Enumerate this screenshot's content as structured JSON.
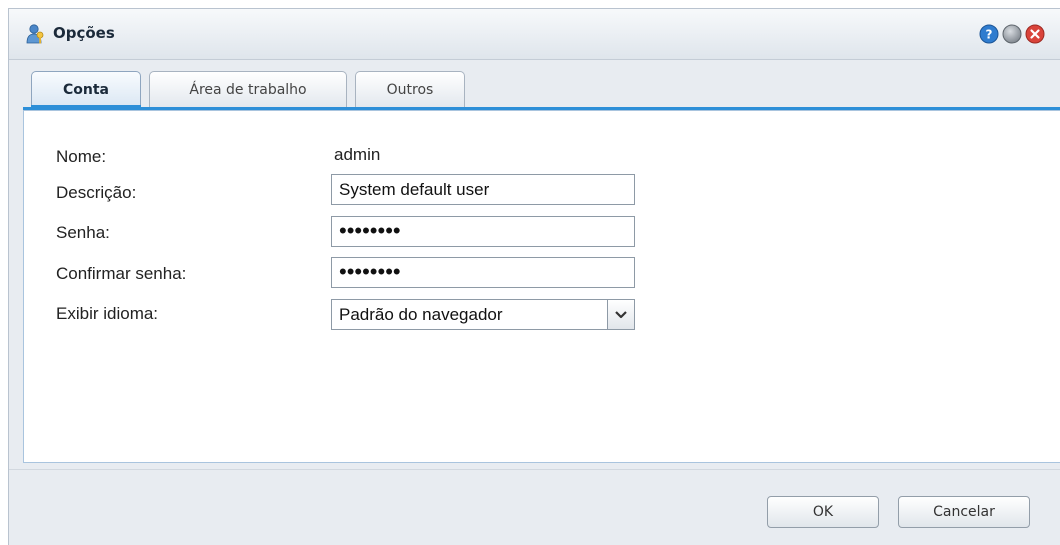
{
  "window": {
    "title": "Opções",
    "icons": [
      "person-key-icon",
      "help-icon",
      "minimize-icon",
      "close-icon"
    ]
  },
  "tabs": [
    {
      "label": "Conta",
      "active": true
    },
    {
      "label": "Área de trabalho",
      "active": false
    },
    {
      "label": "Outros",
      "active": false
    }
  ],
  "form": {
    "name_label": "Nome:",
    "name_value": "admin",
    "description_label": "Descrição:",
    "description_value": "System default user",
    "password_label": "Senha:",
    "password_value": "••••••••",
    "confirm_label": "Confirmar senha:",
    "confirm_value": "••••••••",
    "language_label": "Exibir idioma:",
    "language_value": "Padrão do navegador"
  },
  "buttons": {
    "ok": "OK",
    "cancel": "Cancelar"
  },
  "colors": {
    "accent": "#2d8fd8",
    "close": "#d9433a",
    "help": "#2f7ccf"
  }
}
